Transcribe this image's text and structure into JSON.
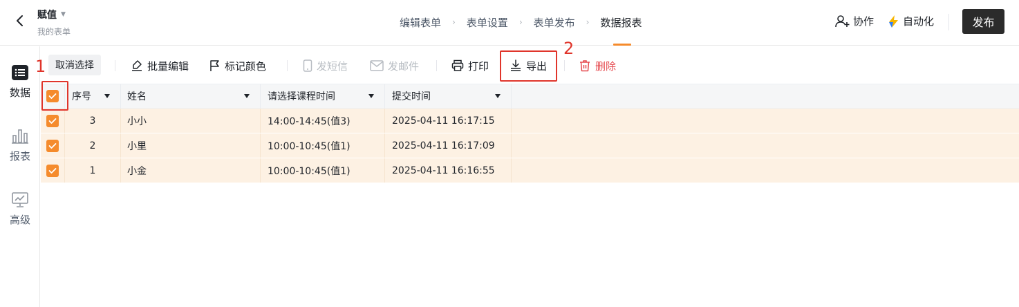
{
  "header": {
    "app_title": "赋值",
    "app_subtitle": "我的表单",
    "steps": [
      "编辑表单",
      "表单设置",
      "表单发布",
      "数据报表"
    ],
    "active_step": "数据报表",
    "collab_label": "协作",
    "auto_label": "自动化",
    "publish_label": "发布"
  },
  "rail": {
    "items": [
      {
        "label": "数据",
        "icon": "list-icon",
        "active": true
      },
      {
        "label": "报表",
        "icon": "bar-chart-icon",
        "active": false
      },
      {
        "label": "高级",
        "icon": "presentation-chart-icon",
        "active": false
      }
    ]
  },
  "toolbar": {
    "cancel_select": "取消选择",
    "batch_edit": "批量编辑",
    "mark_color": "标记颜色",
    "send_sms": "发短信",
    "send_email": "发邮件",
    "print": "打印",
    "export": "导出",
    "delete": "删除"
  },
  "table": {
    "columns": [
      "序号",
      "姓名",
      "请选择课程时间",
      "提交时间"
    ],
    "rows": [
      {
        "index": "3",
        "name": "小小",
        "course_time": "14:00-14:45(值3)",
        "submitted": "2025-04-11 16:17:15"
      },
      {
        "index": "2",
        "name": "小里",
        "course_time": "10:00-10:45(值1)",
        "submitted": "2025-04-11 16:17:09"
      },
      {
        "index": "1",
        "name": "小金",
        "course_time": "10:00-10:45(值1)",
        "submitted": "2025-04-11 16:16:55"
      }
    ]
  },
  "annotations": {
    "step1": "1",
    "step2": "2"
  },
  "colors": {
    "accent": "#f58b2c",
    "selected_row": "#fdf1e3",
    "annotation": "#e0352b",
    "danger": "#e5484d"
  }
}
